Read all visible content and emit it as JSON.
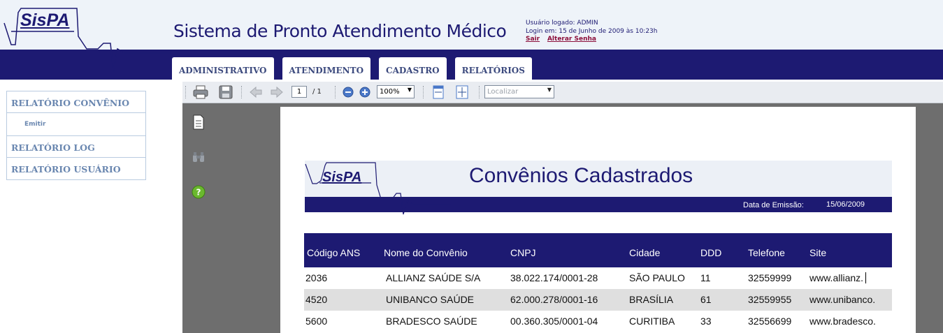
{
  "header": {
    "logo_text": "SisPA",
    "title": "Sistema de Pronto Atendimento Médico",
    "user_line": "Usuário logado: ADMIN",
    "login_line": "Login em: 15 de Junho de 2009 às 10:23h",
    "logout_link": "Sair",
    "change_password_link": "Alterar Senha"
  },
  "tabs": [
    {
      "label": "ADMINISTRATIVO"
    },
    {
      "label": "ATENDIMENTO"
    },
    {
      "label": "CADASTRO"
    },
    {
      "label": "RELATÓRIOS"
    }
  ],
  "sidebar": {
    "items": [
      {
        "label": "RELATÓRIO CONVÊNIO"
      },
      {
        "label": "Emitir"
      },
      {
        "label": "RELATÓRIO LOG"
      },
      {
        "label": "RELATÓRIO USUÁRIO"
      }
    ]
  },
  "toolbar": {
    "page_current": "1",
    "page_total": "/ 1",
    "zoom": "100%",
    "find_placeholder": "Localizar",
    "icons": [
      "print-icon",
      "save-icon",
      "back-icon",
      "forward-icon",
      "zoom-out-icon",
      "zoom-in-icon",
      "page-width-icon",
      "fit-page-icon"
    ]
  },
  "report": {
    "logo_text": "SisPA",
    "title": "Convênios Cadastrados",
    "date_label": "Data de Emissão:",
    "date_value": "15/06/2009",
    "columns": [
      "Código ANS",
      "Nome do Convênio",
      "CNPJ",
      "Cidade",
      "DDD",
      "Telefone",
      "Site"
    ],
    "rows": [
      [
        "2036",
        "ALLIANZ SAÚDE S/A",
        "38.022.174/0001-28",
        "SÃO PAULO",
        "11",
        "32559999",
        "www.allianz."
      ],
      [
        "4520",
        "UNIBANCO SAÚDE",
        "62.000.278/0001-16",
        "BRASÍLIA",
        "61",
        "32559955",
        "www.unibanco."
      ],
      [
        "5600",
        "BRADESCO SAÚDE",
        "00.360.305/0001-04",
        "CURITIBA",
        "33",
        "32556699",
        "www.bradesco."
      ]
    ]
  },
  "colors": {
    "brand_navy": "#1d1a72",
    "header_bg": "#eef3f9",
    "link_maroon": "#8b0e3a",
    "viewer_gray": "#6e6e6e"
  }
}
